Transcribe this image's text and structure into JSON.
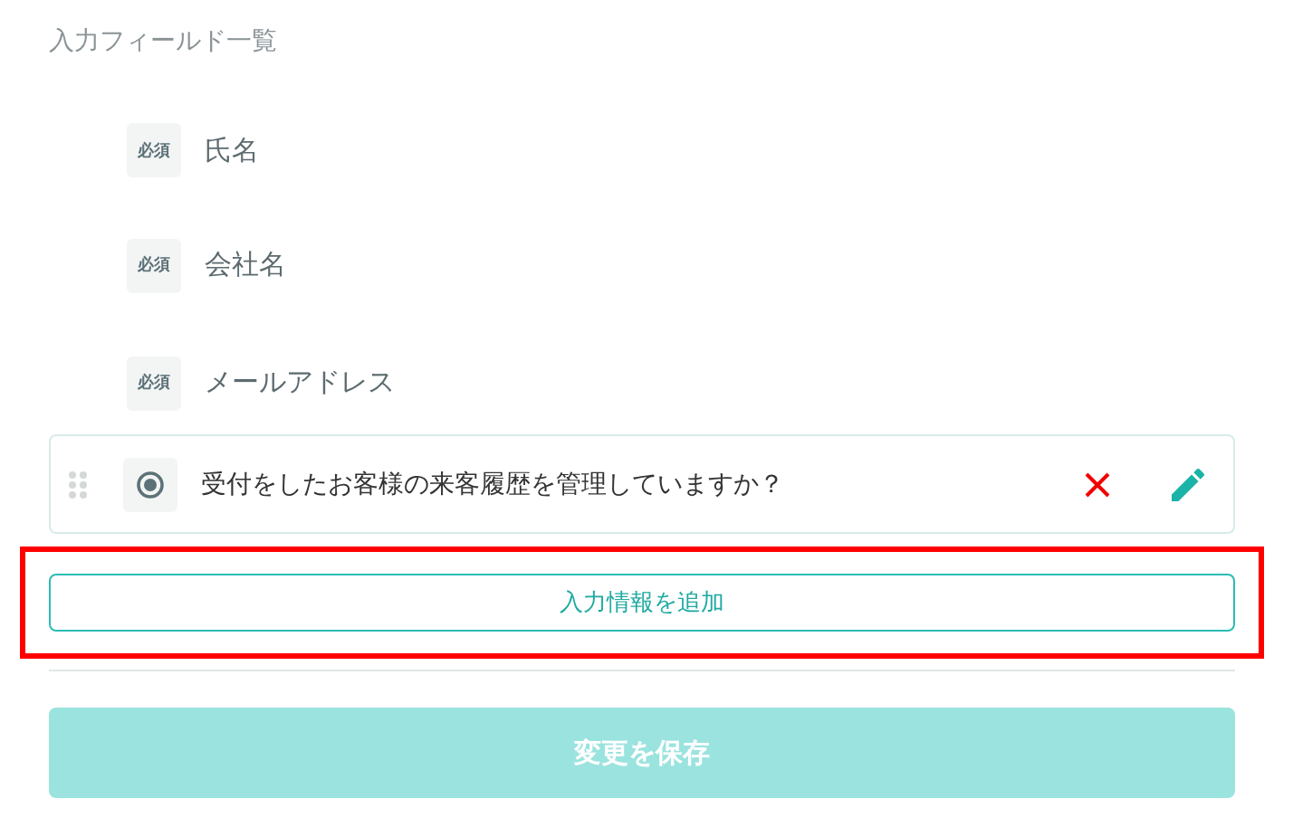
{
  "section_title": "入力フィールド一覧",
  "fields": [
    {
      "kind": "fixed",
      "badge": "必須",
      "label": "氏名"
    },
    {
      "kind": "fixed",
      "badge": "必須",
      "label": "会社名"
    },
    {
      "kind": "fixed",
      "badge": "必須",
      "label": "メールアドレス"
    },
    {
      "kind": "custom",
      "label": "受付をしたお客様の来客履歴を管理していますか？"
    }
  ],
  "add_button": {
    "label": "入力情報を追加",
    "highlighted": true
  },
  "save_button": {
    "label": "変更を保存",
    "disabled": true
  }
}
